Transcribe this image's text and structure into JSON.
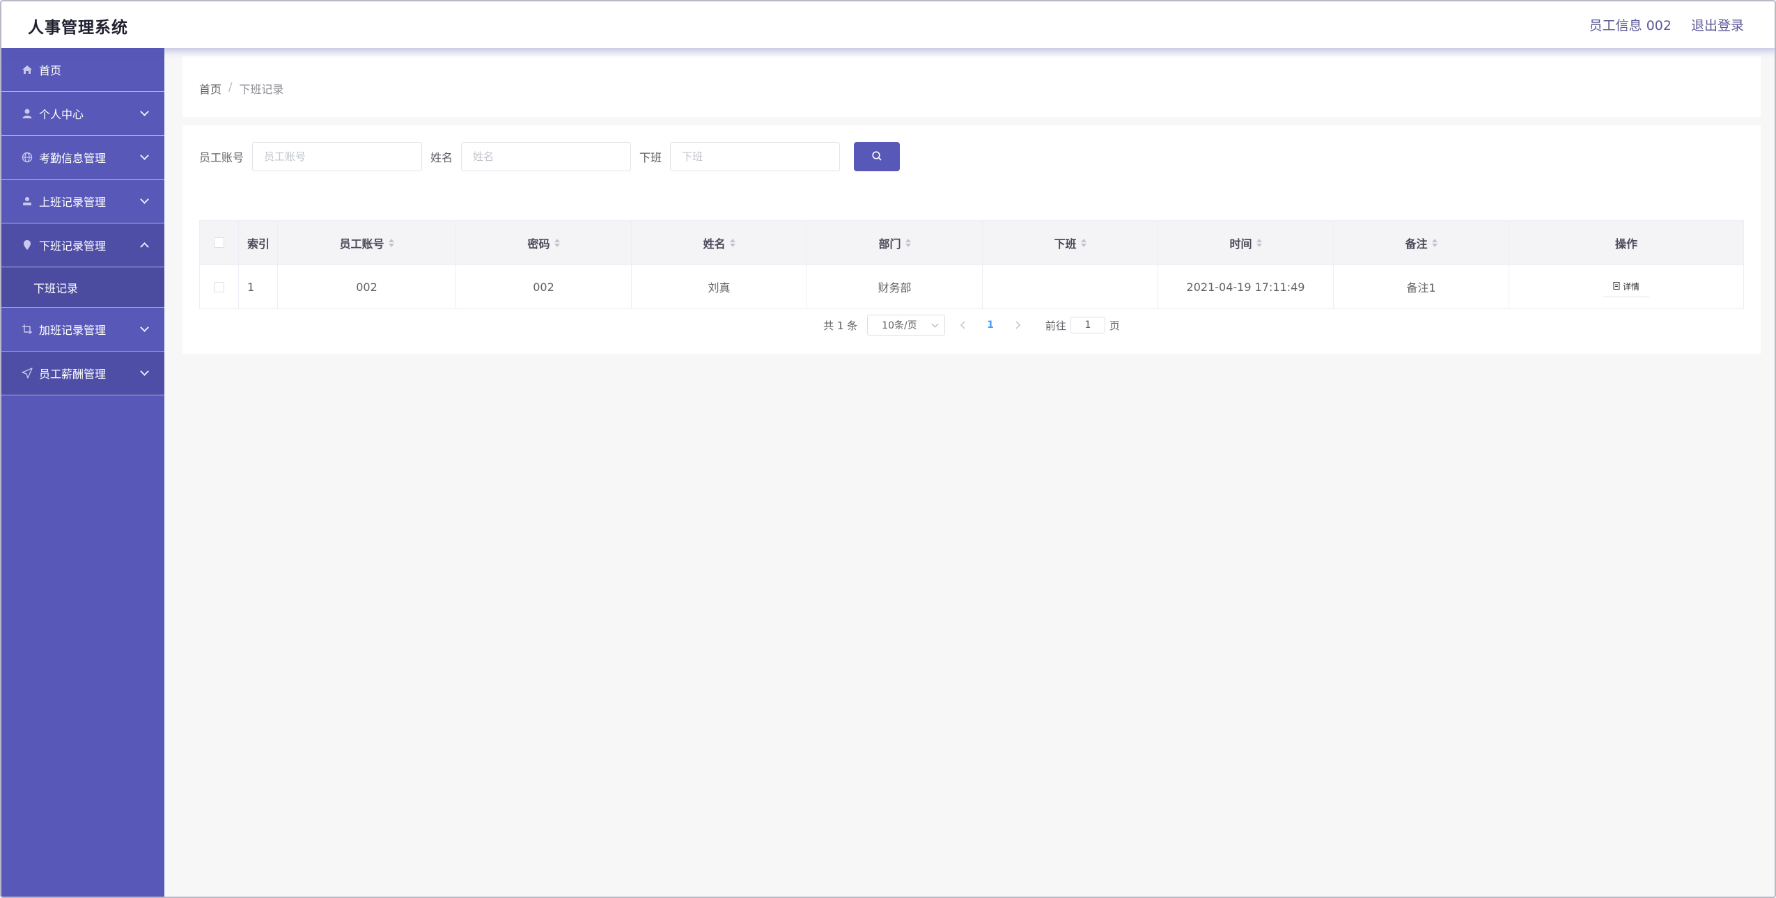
{
  "app": {
    "title": "人事管理系统"
  },
  "header": {
    "user_info": "员工信息 002",
    "logout": "退出登录"
  },
  "sidebar": {
    "items": [
      {
        "label": "首页",
        "icon": "home-icon"
      },
      {
        "label": "个人中心",
        "icon": "user-icon"
      },
      {
        "label": "考勤信息管理",
        "icon": "globe-icon"
      },
      {
        "label": "上班记录管理",
        "icon": "person-icon"
      },
      {
        "label": "下班记录管理",
        "icon": "location-icon"
      },
      {
        "label": "加班记录管理",
        "icon": "crop-icon"
      },
      {
        "label": "员工薪酬管理",
        "icon": "send-icon"
      }
    ],
    "submenu": {
      "label": "下班记录"
    }
  },
  "breadcrumb": {
    "home": "首页",
    "separator": "/",
    "current": "下班记录"
  },
  "search": {
    "account_label": "员工账号",
    "account_placeholder": "员工账号",
    "name_label": "姓名",
    "name_placeholder": "姓名",
    "offwork_label": "下班",
    "offwork_placeholder": "下班"
  },
  "table": {
    "headers": [
      "索引",
      "员工账号",
      "密码",
      "姓名",
      "部门",
      "下班",
      "时间",
      "备注",
      "操作"
    ],
    "rows": [
      {
        "index": "1",
        "account": "002",
        "password": "002",
        "name": "刘真",
        "department": "财务部",
        "offwork": "",
        "time": "2021-04-19 17:11:49",
        "note": "备注1",
        "action": "详情"
      }
    ]
  },
  "pagination": {
    "total": "共 1 条",
    "page_size": "10条/页",
    "current_page": "1",
    "goto_label": "前往",
    "goto_value": "1",
    "page_suffix": "页"
  },
  "colors": {
    "primary": "#5858b8",
    "accent": "#409eff"
  }
}
